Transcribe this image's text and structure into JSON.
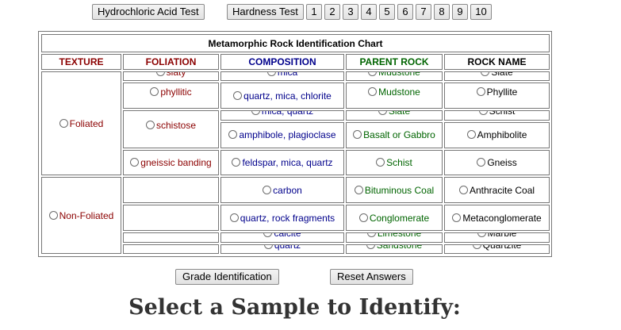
{
  "toolbar": {
    "hcl_label": "Hydrochloric Acid Test",
    "hardness_label": "Hardness Test",
    "numbers": [
      "1",
      "2",
      "3",
      "4",
      "5",
      "6",
      "7",
      "8",
      "9",
      "10"
    ]
  },
  "chart": {
    "title": "Metamorphic Rock Identification Chart",
    "headers": {
      "texture": "TEXTURE",
      "foliation": "FOLIATION",
      "composition": "COMPOSITION",
      "parent_rock": "PARENT ROCK",
      "rock_name": "ROCK NAME"
    },
    "textures": {
      "foliated": "Foliated",
      "non_foliated": "Non-Foliated"
    },
    "foliation": {
      "slaty": "slaty",
      "phyllitic": "phyllitic",
      "schistose": "schistose",
      "gneissic": "gneissic banding"
    },
    "rows": [
      {
        "composition": "mica",
        "parent": "Mudstone",
        "rock": "Slate"
      },
      {
        "composition": "quartz, mica, chlorite",
        "parent": "Mudstone",
        "rock": "Phyllite"
      },
      {
        "composition": "mica, quartz",
        "parent": "Slate",
        "rock": "Schist"
      },
      {
        "composition": "amphibole, plagioclase",
        "parent": "Basalt or Gabbro",
        "rock": "Amphibolite"
      },
      {
        "composition": "feldspar, mica, quartz",
        "parent": "Schist",
        "rock": "Gneiss"
      },
      {
        "composition": "carbon",
        "parent": "Bituminous Coal",
        "rock": "Anthracite Coal"
      },
      {
        "composition": "quartz, rock fragments",
        "parent": "Conglomerate",
        "rock": "Metaconglomerate"
      },
      {
        "composition": "calcite",
        "parent": "Limestone",
        "rock": "Marble"
      },
      {
        "composition": "quartz",
        "parent": "Sandstone",
        "rock": "Quartzite"
      }
    ]
  },
  "actions": {
    "grade_label": "Grade Identification",
    "reset_label": "Reset Answers"
  },
  "heading": "Select a Sample to Identify:",
  "colors": {
    "texture_red": "#8b0000",
    "composition_blue": "#00008b",
    "parent_green": "#006400"
  }
}
